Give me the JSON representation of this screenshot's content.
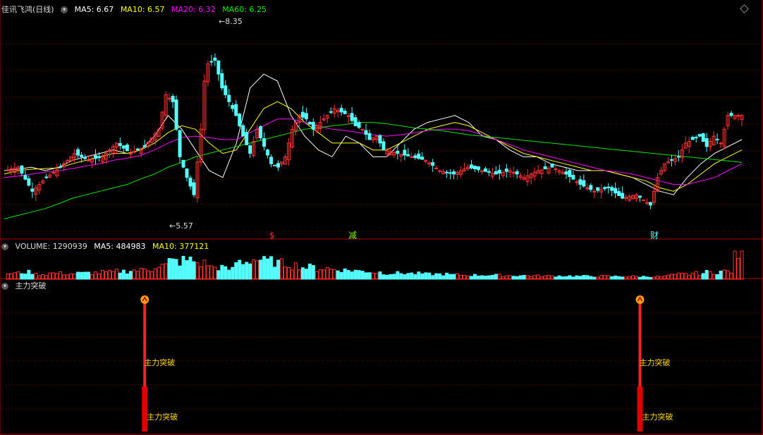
{
  "main_header": {
    "title": "佳讯飞鸿(日线)",
    "ma5": "MA5: 6.67",
    "ma10": "MA10: 6.57",
    "ma20": "MA20: 6.32",
    "ma60": "MA60: 6.25"
  },
  "volume_header": {
    "title": "VOLUME: 1290939",
    "ma5": "MA5: 484983",
    "ma10": "MA10: 377121"
  },
  "indicator_header": {
    "title": "主力突破"
  },
  "colors": {
    "up": "#ff3232",
    "down": "#54fcfc",
    "ma5": "#ffffff",
    "ma10": "#ffff00",
    "ma20": "#ff00ff",
    "ma60": "#00e600",
    "grid": "#7a0000",
    "border": "#b40000"
  },
  "chart_data": [
    {
      "type": "candlestick",
      "name": "price",
      "ylim": [
        5.4,
        8.55
      ],
      "annotations": {
        "high_label": "8.35",
        "low_label": "5.57",
        "event_marks": [
          "$",
          "减",
          "财"
        ]
      },
      "close_points": [
        [
          0,
          6.3
        ],
        [
          4,
          6.35
        ],
        [
          8,
          6.0
        ],
        [
          12,
          6.2
        ],
        [
          16,
          6.35
        ],
        [
          20,
          6.55
        ],
        [
          24,
          6.45
        ],
        [
          28,
          6.5
        ],
        [
          32,
          6.7
        ],
        [
          36,
          6.55
        ],
        [
          40,
          6.65
        ],
        [
          44,
          6.9
        ],
        [
          46,
          7.4
        ],
        [
          48,
          7.3
        ],
        [
          50,
          6.5
        ],
        [
          52,
          6.2
        ],
        [
          54,
          5.95
        ],
        [
          56,
          6.9
        ],
        [
          57,
          7.6
        ],
        [
          58,
          7.85
        ],
        [
          60,
          7.9
        ],
        [
          62,
          7.5
        ],
        [
          64,
          7.3
        ],
        [
          66,
          7.1
        ],
        [
          68,
          6.8
        ],
        [
          70,
          6.55
        ],
        [
          72,
          6.9
        ],
        [
          74,
          6.65
        ],
        [
          76,
          6.4
        ],
        [
          78,
          6.35
        ],
        [
          80,
          6.5
        ],
        [
          82,
          6.9
        ],
        [
          84,
          7.1
        ],
        [
          86,
          7.05
        ],
        [
          88,
          6.9
        ],
        [
          90,
          7.0
        ],
        [
          92,
          7.1
        ],
        [
          94,
          7.2
        ],
        [
          96,
          7.15
        ],
        [
          98,
          7.1
        ],
        [
          100,
          6.95
        ],
        [
          102,
          6.9
        ],
        [
          104,
          6.75
        ],
        [
          106,
          6.8
        ],
        [
          108,
          6.6
        ],
        [
          112,
          6.55
        ],
        [
          116,
          6.5
        ],
        [
          120,
          6.45
        ],
        [
          124,
          6.3
        ],
        [
          128,
          6.25
        ],
        [
          132,
          6.35
        ],
        [
          136,
          6.3
        ],
        [
          140,
          6.25
        ],
        [
          144,
          6.3
        ],
        [
          148,
          6.2
        ],
        [
          152,
          6.3
        ],
        [
          156,
          6.35
        ],
        [
          160,
          6.25
        ],
        [
          164,
          6.1
        ],
        [
          168,
          6.0
        ],
        [
          172,
          6.05
        ],
        [
          176,
          5.9
        ],
        [
          180,
          5.95
        ],
        [
          184,
          5.8
        ],
        [
          186,
          6.2
        ],
        [
          188,
          6.4
        ],
        [
          190,
          6.45
        ],
        [
          192,
          6.5
        ],
        [
          194,
          6.7
        ],
        [
          196,
          6.75
        ],
        [
          198,
          6.8
        ],
        [
          200,
          6.65
        ],
        [
          202,
          6.8
        ],
        [
          204,
          6.7
        ],
        [
          206,
          7.1
        ]
      ],
      "ma_series": [
        {
          "name": "MA5",
          "color": "#ffffff",
          "values": [
            6.3,
            6.32,
            6.35,
            6.3,
            6.35,
            6.45,
            6.5,
            6.55,
            6.6,
            6.55,
            6.6,
            6.8,
            7.1,
            6.9,
            6.6,
            6.3,
            6.2,
            6.7,
            7.5,
            7.7,
            7.6,
            7.1,
            6.8,
            6.6,
            6.5,
            6.8,
            6.7,
            6.5,
            6.5,
            6.7,
            6.9,
            7.0,
            7.05,
            7.1,
            7.0,
            6.8,
            6.75,
            6.6,
            6.5,
            6.5,
            6.4,
            6.35,
            6.3,
            6.3,
            6.3,
            6.25,
            6.2,
            6.1,
            6.0,
            5.95,
            6.2,
            6.4,
            6.55,
            6.65,
            6.75
          ]
        },
        {
          "name": "MA10",
          "color": "#ffff00",
          "values": [
            6.25,
            6.3,
            6.32,
            6.33,
            6.34,
            6.4,
            6.45,
            6.5,
            6.55,
            6.55,
            6.6,
            6.7,
            6.85,
            6.95,
            6.9,
            6.7,
            6.55,
            6.6,
            6.9,
            7.2,
            7.3,
            7.2,
            7.0,
            6.85,
            6.7,
            6.7,
            6.7,
            6.6,
            6.6,
            6.7,
            6.8,
            6.9,
            6.95,
            7.0,
            6.95,
            6.85,
            6.75,
            6.65,
            6.55,
            6.5,
            6.45,
            6.4,
            6.35,
            6.3,
            6.3,
            6.25,
            6.2,
            6.15,
            6.05,
            6.0,
            6.1,
            6.25,
            6.4,
            6.5,
            6.6
          ]
        },
        {
          "name": "MA20",
          "color": "#ff00ff",
          "values": [
            6.2,
            6.22,
            6.25,
            6.28,
            6.3,
            6.33,
            6.37,
            6.4,
            6.45,
            6.48,
            6.52,
            6.6,
            6.7,
            6.78,
            6.8,
            6.78,
            6.75,
            6.75,
            6.85,
            6.95,
            7.05,
            7.05,
            7.0,
            6.95,
            6.9,
            6.88,
            6.85,
            6.82,
            6.8,
            6.82,
            6.85,
            6.88,
            6.9,
            6.9,
            6.88,
            6.82,
            6.75,
            6.68,
            6.6,
            6.55,
            6.5,
            6.45,
            6.4,
            6.35,
            6.3,
            6.28,
            6.25,
            6.2,
            6.15,
            6.1,
            6.1,
            6.15,
            6.2,
            6.3,
            6.4
          ]
        },
        {
          "name": "MA60",
          "color": "#00e600",
          "values": [
            5.6,
            5.65,
            5.7,
            5.75,
            5.82,
            5.9,
            5.95,
            6.0,
            6.05,
            6.1,
            6.18,
            6.25,
            6.35,
            6.42,
            6.5,
            6.55,
            6.6,
            6.65,
            6.7,
            6.75,
            6.8,
            6.85,
            6.9,
            6.92,
            6.95,
            6.97,
            7.0,
            7.0,
            6.98,
            6.95,
            6.92,
            6.9,
            6.88,
            6.85,
            6.82,
            6.8,
            6.78,
            6.76,
            6.74,
            6.72,
            6.7,
            6.68,
            6.66,
            6.64,
            6.62,
            6.6,
            6.58,
            6.56,
            6.54,
            6.52,
            6.5,
            6.48,
            6.46,
            6.44,
            6.42
          ]
        }
      ]
    },
    {
      "type": "bar",
      "name": "volume",
      "values": [
        0.3,
        0.35,
        0.25,
        0.3,
        0.28,
        0.3,
        0.32,
        0.35,
        0.4,
        0.45,
        0.5,
        0.7,
        0.9,
        0.95,
        0.8,
        0.6,
        0.5,
        0.9,
        1.0,
        0.9,
        0.8,
        0.7,
        0.6,
        0.55,
        0.5,
        0.45,
        0.4,
        0.35,
        0.3,
        0.3,
        0.28,
        0.25,
        0.25,
        0.22,
        0.2,
        0.2,
        0.2,
        0.18,
        0.18,
        0.17,
        0.16,
        0.16,
        0.15,
        0.15,
        0.15,
        0.14,
        0.14,
        0.13,
        0.13,
        0.2,
        0.25,
        0.3,
        0.35,
        0.4,
        1.3
      ]
    },
    {
      "type": "signal",
      "name": "主力突破",
      "signal_label": "主力突破",
      "signals_at": [
        41,
        182
      ]
    }
  ]
}
